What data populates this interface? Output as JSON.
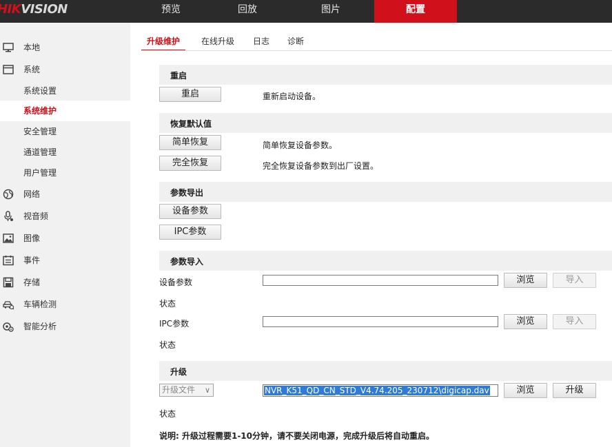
{
  "brand": {
    "logo_prefix": "HIK",
    "logo_suffix": "VISION"
  },
  "topnav": [
    {
      "label": "预览"
    },
    {
      "label": "回放"
    },
    {
      "label": "图片"
    },
    {
      "label": "配置"
    }
  ],
  "sidebar": {
    "items": [
      {
        "label": "本地",
        "icon": "monitor-icon"
      },
      {
        "label": "系统",
        "icon": "system-icon"
      },
      {
        "label": "系统设置"
      },
      {
        "label": "系统维护"
      },
      {
        "label": "安全管理"
      },
      {
        "label": "通道管理"
      },
      {
        "label": "用户管理"
      },
      {
        "label": "网络",
        "icon": "globe-icon"
      },
      {
        "label": "视音频",
        "icon": "microphone-icon"
      },
      {
        "label": "图像",
        "icon": "image-icon"
      },
      {
        "label": "事件",
        "icon": "calendar-icon"
      },
      {
        "label": "存储",
        "icon": "disk-icon"
      },
      {
        "label": "车辆检测",
        "icon": "vehicle-detect-icon"
      },
      {
        "label": "智能分析",
        "icon": "analytics-icon"
      }
    ]
  },
  "tabs": [
    {
      "label": "升级维护"
    },
    {
      "label": "在线升级"
    },
    {
      "label": "日志"
    },
    {
      "label": "诊断"
    }
  ],
  "sections": {
    "reboot": {
      "title": "重启",
      "button": "重启",
      "desc": "重新启动设备。"
    },
    "restore": {
      "title": "恢复默认值",
      "simple_button": "简单恢复",
      "simple_desc": "简单恢复设备参数。",
      "full_button": "完全恢复",
      "full_desc": "完全恢复设备参数到出厂设置。"
    },
    "export": {
      "title": "参数导出",
      "device_button": "设备参数",
      "ipc_button": "IPC参数"
    },
    "import": {
      "title": "参数导入",
      "device_label": "设备参数",
      "device_value": "",
      "browse_label": "浏览",
      "import_label": "导入",
      "status_label": "状态",
      "ipc_label": "IPC参数",
      "ipc_value": ""
    },
    "upgrade": {
      "title": "升级",
      "select_value": "升级文件",
      "file_value": "NVR_K51_QD_CN_STD_V4.74.205_230712\\digicap.dav",
      "browse_label": "浏览",
      "upgrade_label": "升级",
      "status_label": "状态",
      "note": "说明: 升级过程需要1-10分钟，请不要关闭电源，完成升级后将自动重启。"
    }
  }
}
